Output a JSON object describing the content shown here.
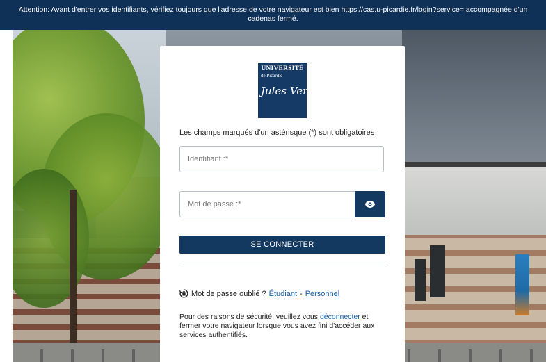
{
  "banner": {
    "text": "Attention: Avant d'entrer vos identifiants, vérifiez toujours que l'adresse de votre navigateur est bien https://cas.u-picardie.fr/login?service= accompagnée d'un cadenas fermé."
  },
  "logo": {
    "line1": "UNIVERSITÉ",
    "line2": "de Picardie",
    "line3": "Jules Verne"
  },
  "form": {
    "required_note": "Les champs marqués d'un astérisque (*) sont obligatoires",
    "username_placeholder": "Identifiant :*",
    "username_value": "",
    "password_placeholder": "Mot de passe :*",
    "password_value": "",
    "show_password_icon": "eye-icon",
    "submit_label": "SE CONNECTER"
  },
  "forgot": {
    "icon": "lock-reset-icon",
    "label": "Mot de passe oublié ?",
    "student_link": "Étudiant",
    "separator": "-",
    "staff_link": "Personnel"
  },
  "security": {
    "before": "Pour des raisons de sécurité, veuillez vous",
    "link": "déconnecter",
    "after": "et fermer votre navigateur lorsque vous avez fini d'accéder aux services authentifiés."
  },
  "colors": {
    "primary": "#143961",
    "banner": "#0f3057",
    "link": "#1a5ea8"
  }
}
